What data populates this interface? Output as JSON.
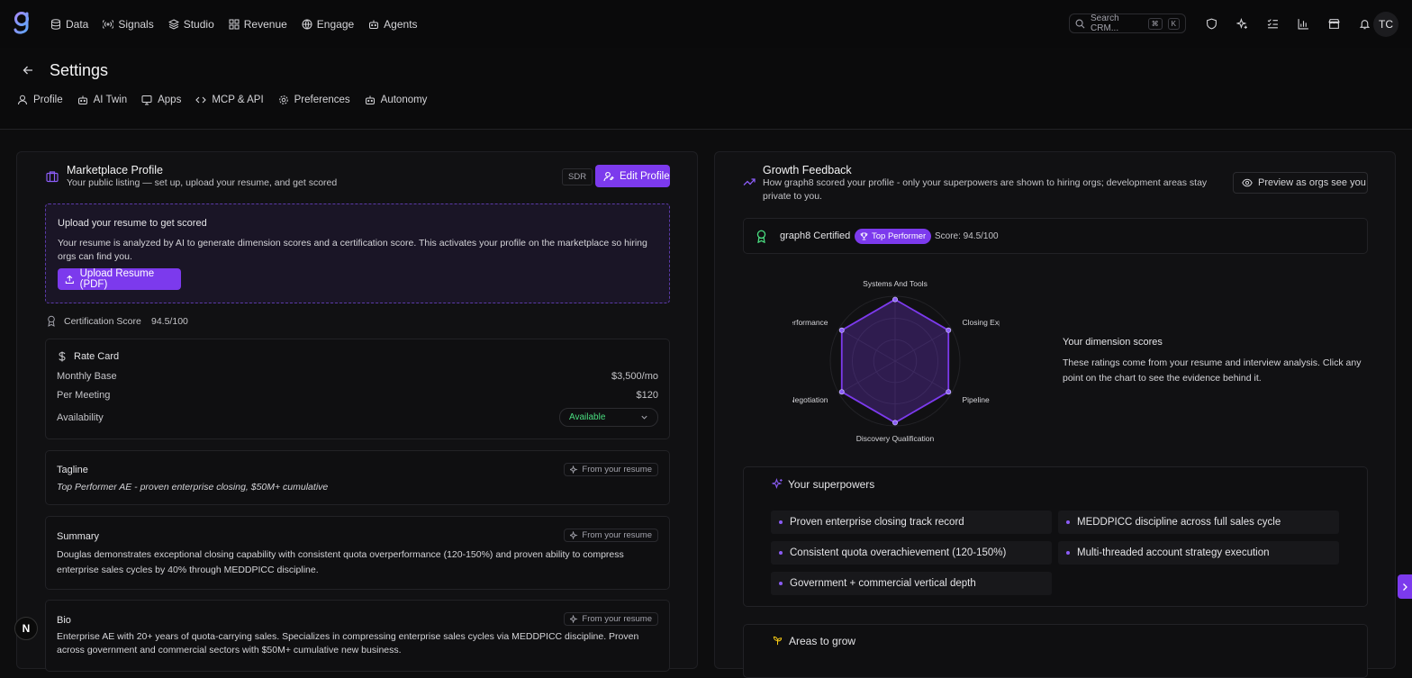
{
  "nav": {
    "items": [
      {
        "label": "Data",
        "icon": "database-icon"
      },
      {
        "label": "Signals",
        "icon": "signal-icon"
      },
      {
        "label": "Studio",
        "icon": "studio-icon"
      },
      {
        "label": "Revenue",
        "icon": "grid-icon"
      },
      {
        "label": "Engage",
        "icon": "globe-icon"
      },
      {
        "label": "Agents",
        "icon": "bot-icon"
      }
    ],
    "search_placeholder": "Search CRM...",
    "search_kbd_1": "⌘",
    "search_kbd_2": "K",
    "avatar_initials": "TC"
  },
  "header": {
    "title": "Settings",
    "tabs": [
      {
        "label": "Profile"
      },
      {
        "label": "AI Twin"
      },
      {
        "label": "Apps"
      },
      {
        "label": "MCP & API"
      },
      {
        "label": "Preferences"
      },
      {
        "label": "Autonomy"
      }
    ]
  },
  "marketplace": {
    "title": "Marketplace Profile",
    "subtitle": "Your public listing — set up, upload your resume, and get scored",
    "role_badge": "SDR",
    "edit_label": "Edit Profile",
    "upload": {
      "title": "Upload your resume to get scored",
      "body": "Your resume is analyzed by AI to generate dimension scores and a certification score. This activates your profile on the marketplace so hiring orgs can find you.",
      "button": "Upload Resume (PDF)"
    },
    "certification_label": "Certification Score",
    "certification_value": "94.5/100",
    "rate_card": {
      "title": "Rate Card",
      "monthly_label": "Monthly Base",
      "monthly_value": "$3,500/mo",
      "meeting_label": "Per Meeting",
      "meeting_value": "$120",
      "availability_label": "Availability",
      "availability_value": "Available"
    },
    "from_resume": "From your resume",
    "tagline_label": "Tagline",
    "tagline_value": "Top Performer AE - proven enterprise closing, $50M+ cumulative",
    "summary_label": "Summary",
    "summary_value": "Douglas demonstrates exceptional closing capability with consistent quota overperformance (120-150%) and proven ability to compress enterprise sales cycles by 40% through MEDDPICC discipline.",
    "bio_label": "Bio",
    "bio_value": "Enterprise AE with 20+ years of quota-carrying sales. Specializes in compressing enterprise sales cycles via MEDDPICC discipline. Proven across government and commercial sectors with $50M+ cumulative new business."
  },
  "growth": {
    "title": "Growth Feedback",
    "subtitle": "How graph8 scored your profile - only your superpowers are shown to hiring orgs; development areas stay private to you.",
    "preview_label": "Preview as orgs see you",
    "certified_label": "graph8 Certified",
    "top_performer": "Top Performer",
    "score_text": "Score: 94.5/100",
    "dimension_title": "Your dimension scores",
    "dimension_body": "These ratings come from your resume and interview analysis. Click any point on the chart to see the evidence behind it.",
    "superpowers_title": "Your superpowers",
    "superpowers": [
      "Proven enterprise closing track record",
      "MEDDPICC discipline across full sales cycle",
      "Consistent quota overachievement (120-150%)",
      "Multi-threaded account strategy execution",
      "Government + commercial vertical depth"
    ],
    "areas_title": "Areas to grow"
  },
  "chart_data": {
    "type": "radar",
    "categories": [
      "Systems And Tools",
      "Closing Experience",
      "Pipeline",
      "Discovery Qualification",
      "Strategy Negotiation",
      "Quota Performance"
    ],
    "displayed_labels": [
      "Systems And Tools",
      "Closing Experie",
      "Pipeline",
      "Discovery Qualification",
      "rategy Negotiation",
      "Quota Performance"
    ],
    "values": [
      95,
      95,
      95,
      95,
      95,
      95
    ],
    "ylim": [
      0,
      100
    ]
  },
  "colors": {
    "accent": "#7c3aed",
    "accent_light": "#8b5cf6",
    "available": "#4ade80",
    "background": "#0d0d0e"
  },
  "misc": {
    "n_badge": "N"
  }
}
